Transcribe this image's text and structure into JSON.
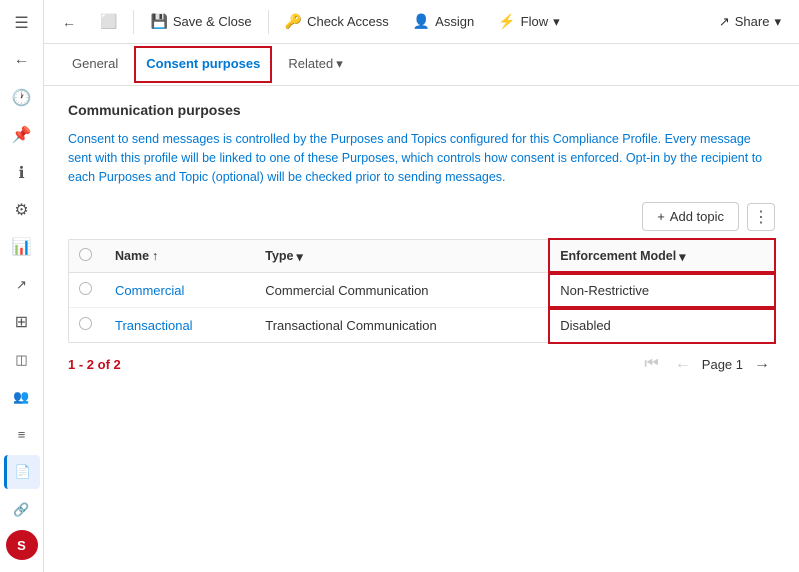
{
  "toolbar": {
    "back_icon": "←",
    "restore_icon": "⬜",
    "save_close_icon": "💾",
    "save_close_label": "Save & Close",
    "check_access_icon": "🔑",
    "check_access_label": "Check Access",
    "assign_icon": "👤",
    "assign_label": "Assign",
    "flow_icon": "⚡",
    "flow_label": "Flow",
    "flow_dropdown": "▾",
    "share_icon": "↗",
    "share_label": "Share",
    "share_dropdown": "▾"
  },
  "tabs": {
    "general": "General",
    "consent_purposes": "Consent purposes",
    "related": "Related",
    "related_dropdown": "▾"
  },
  "content": {
    "section_title": "Communication purposes",
    "description": "Consent to send messages is controlled by the Purposes and Topics configured for this Compliance Profile. Every message sent with this profile will be linked to one of these Purposes, which controls how consent is enforced. Opt-in by the recipient to each Purposes and Topic (optional) will be checked prior to sending messages.",
    "add_topic_label": "Add topic",
    "more_icon": "⋮",
    "table": {
      "col_select": "",
      "col_name": "Name",
      "col_name_sort": "↑",
      "col_type": "Type",
      "col_type_dropdown": "▾",
      "col_enforcement": "Enforcement Model",
      "col_enforcement_dropdown": "▾",
      "rows": [
        {
          "name": "Commercial",
          "type": "Commercial Communication",
          "enforcement": "Non-Restrictive"
        },
        {
          "name": "Transactional",
          "type": "Transactional Communication",
          "enforcement": "Disabled"
        }
      ]
    },
    "pagination": {
      "range": "1 - 2 of 2",
      "first_icon": "⏮",
      "prev_icon": "←",
      "page_label": "Page 1",
      "next_icon": "→"
    }
  },
  "sidebar": {
    "icons": [
      {
        "name": "menu-icon",
        "symbol": "☰"
      },
      {
        "name": "clock-icon",
        "symbol": "🕐"
      },
      {
        "name": "pin-icon",
        "symbol": "📌"
      },
      {
        "name": "info-icon",
        "symbol": "ℹ"
      },
      {
        "name": "settings-icon",
        "symbol": "⚙"
      },
      {
        "name": "chart-icon",
        "symbol": "📊"
      },
      {
        "name": "graph-icon",
        "symbol": "📈"
      },
      {
        "name": "grid-icon",
        "symbol": "⊞"
      },
      {
        "name": "tag-icon",
        "symbol": "🏷"
      },
      {
        "name": "people-icon",
        "symbol": "👥"
      },
      {
        "name": "list2-icon",
        "symbol": "≡"
      },
      {
        "name": "file-icon",
        "symbol": "📄"
      },
      {
        "name": "link-icon",
        "symbol": "🔗"
      }
    ],
    "avatar": "S"
  }
}
